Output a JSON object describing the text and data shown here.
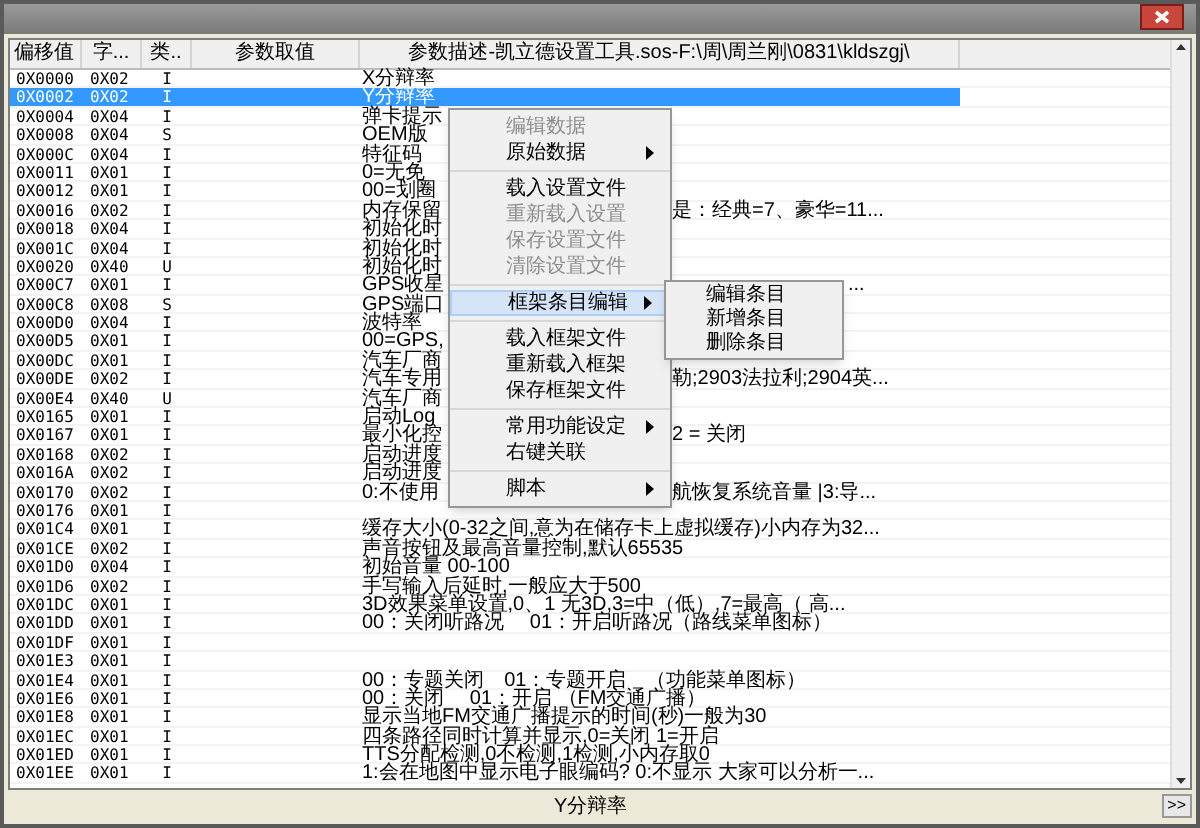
{
  "columns": [
    "偏移值",
    "字...",
    "类..",
    "参数取值",
    "参数描述-凯立德设置工具.sos-F:\\周\\周兰刚\\0831\\kldszgj\\"
  ],
  "rows": [
    {
      "offset": "0X0000",
      "size": "0X02",
      "type": "I",
      "description": "X分辩率",
      "selected": false
    },
    {
      "offset": "0X0002",
      "size": "0X02",
      "type": "I",
      "description": "Y分辩率",
      "selected": true
    },
    {
      "offset": "0X0004",
      "size": "0X04",
      "type": "I",
      "description": "弹卡提示",
      "selected": false
    },
    {
      "offset": "0X0008",
      "size": "0X04",
      "type": "S",
      "description": "OEM版",
      "selected": false
    },
    {
      "offset": "0X000C",
      "size": "0X04",
      "type": "I",
      "description": "特征码",
      "selected": false
    },
    {
      "offset": "0X0011",
      "size": "0X01",
      "type": "I",
      "description": "0=无免",
      "selected": false
    },
    {
      "offset": "0X0012",
      "size": "0X01",
      "type": "I",
      "description": "00=划圈",
      "selected": false
    },
    {
      "offset": "0X0016",
      "size": "0X02",
      "type": "I",
      "description": "内存保留",
      "description_tail": "是：经典=7、豪华=11...",
      "selected": false
    },
    {
      "offset": "0X0018",
      "size": "0X04",
      "type": "I",
      "description": "初始化时",
      "selected": false
    },
    {
      "offset": "0X001C",
      "size": "0X04",
      "type": "I",
      "description": "初始化时",
      "selected": false
    },
    {
      "offset": "0X0020",
      "size": "0X40",
      "type": "U",
      "description": "初始化时",
      "selected": false
    },
    {
      "offset": "0X00C7",
      "size": "0X01",
      "type": "I",
      "description": "GPS收星",
      "description_tail": "...",
      "kind": "tail_past_submenu",
      "selected": false
    },
    {
      "offset": "0X00C8",
      "size": "0X08",
      "type": "S",
      "description": "GPS端口",
      "selected": false
    },
    {
      "offset": "0X00D0",
      "size": "0X04",
      "type": "I",
      "description": "波特率",
      "selected": false
    },
    {
      "offset": "0X00D5",
      "size": "0X01",
      "type": "I",
      "description": "00=GPS,",
      "selected": false
    },
    {
      "offset": "0X00DC",
      "size": "0X01",
      "type": "I",
      "description": "汽车厂商",
      "selected": false
    },
    {
      "offset": "0X00DE",
      "size": "0X02",
      "type": "I",
      "description": "汽车专用",
      "description_tail": "勒;2903法拉利;2904英...",
      "selected": false
    },
    {
      "offset": "0X00E4",
      "size": "0X40",
      "type": "U",
      "description": "汽车厂商",
      "selected": false
    },
    {
      "offset": "0X0165",
      "size": "0X01",
      "type": "I",
      "description": "启动Log",
      "selected": false
    },
    {
      "offset": "0X0167",
      "size": "0X01",
      "type": "I",
      "description": "最小化控",
      "description_tail": "2 = 关闭",
      "selected": false
    },
    {
      "offset": "0X0168",
      "size": "0X02",
      "type": "I",
      "description": "启动进度",
      "selected": false
    },
    {
      "offset": "0X016A",
      "size": "0X02",
      "type": "I",
      "description": "启动进度",
      "selected": false
    },
    {
      "offset": "0X0170",
      "size": "0X02",
      "type": "I",
      "description": "0:不使用",
      "description_tail": "航恢复系统音量 |3:导...",
      "selected": false
    },
    {
      "offset": "0X0176",
      "size": "0X01",
      "type": "I",
      "selected": false
    },
    {
      "offset": "0X01C4",
      "size": "0X01",
      "type": "I",
      "description": "缓存大小(0-32之间,意为在储存卡上虚拟缓存)小内存为32...",
      "selected": false
    },
    {
      "offset": "0X01CE",
      "size": "0X02",
      "type": "I",
      "description": "声音按钮及最高音量控制,默认65535",
      "selected": false
    },
    {
      "offset": "0X01D0",
      "size": "0X04",
      "type": "I",
      "description": "初始音量 00-100",
      "selected": false
    },
    {
      "offset": "0X01D6",
      "size": "0X02",
      "type": "I",
      "description": "手写输入后延时,一般应大于500",
      "selected": false
    },
    {
      "offset": "0X01DC",
      "size": "0X01",
      "type": "I",
      "description": "3D效果菜单设置,0、1 无3D,3=中（低）,7=最高（ 高...",
      "selected": false
    },
    {
      "offset": "0X01DD",
      "size": "0X01",
      "type": "I",
      "description": "00：关闭听路况　 01：开启听路况（路线菜单图标）",
      "selected": false
    },
    {
      "offset": "0X01DF",
      "size": "0X01",
      "type": "I",
      "selected": false
    },
    {
      "offset": "0X01E3",
      "size": "0X01",
      "type": "I",
      "selected": false
    },
    {
      "offset": "0X01E4",
      "size": "0X01",
      "type": "I",
      "description": "00：专题关闭　01：专题开启　（功能菜单图标）",
      "selected": false
    },
    {
      "offset": "0X01E6",
      "size": "0X01",
      "type": "I",
      "description": "00：关闭　 01：开启 （FM交通广播）",
      "selected": false
    },
    {
      "offset": "0X01E8",
      "size": "0X01",
      "type": "I",
      "description": "显示当地FM交通广播提示的时间(秒)一般为30",
      "selected": false
    },
    {
      "offset": "0X01EC",
      "size": "0X01",
      "type": "I",
      "description": "四条路径同时计算并显示,0=关闭 1=开启",
      "selected": false
    },
    {
      "offset": "0X01ED",
      "size": "0X01",
      "type": "I",
      "description": "TTS分配检测,0不检测,1检测,小内存取0",
      "selected": false
    },
    {
      "offset": "0X01EE",
      "size": "0X01",
      "type": "I",
      "description": "1:会在地图中显示电子眼编码? 0:不显示 大家可以分析一...",
      "selected": false
    }
  ],
  "context_menu": {
    "groups": [
      [
        {
          "label": "编辑数据",
          "disabled": true,
          "selected": false,
          "submenu": false
        },
        {
          "label": "原始数据",
          "disabled": false,
          "selected": false,
          "submenu": true
        }
      ],
      [
        {
          "label": "载入设置文件",
          "disabled": false,
          "selected": false,
          "submenu": false
        },
        {
          "label": "重新载入设置",
          "disabled": true,
          "selected": false,
          "submenu": false
        },
        {
          "label": "保存设置文件",
          "disabled": true,
          "selected": false,
          "submenu": false
        },
        {
          "label": "清除设置文件",
          "disabled": true,
          "selected": false,
          "submenu": false
        }
      ],
      [
        {
          "label": "框架条目编辑",
          "disabled": false,
          "selected": true,
          "submenu": true
        }
      ],
      [
        {
          "label": "载入框架文件",
          "disabled": false,
          "selected": false,
          "submenu": false
        },
        {
          "label": "重新载入框架",
          "disabled": false,
          "selected": false,
          "submenu": false
        },
        {
          "label": "保存框架文件",
          "disabled": false,
          "selected": false,
          "submenu": false
        }
      ],
      [
        {
          "label": "常用功能设定",
          "disabled": false,
          "selected": false,
          "submenu": true
        },
        {
          "label": "右键关联",
          "disabled": false,
          "selected": false,
          "submenu": false
        }
      ],
      [
        {
          "label": "脚本",
          "disabled": false,
          "selected": false,
          "submenu": true
        }
      ]
    ]
  },
  "submenu": [
    "编辑条目",
    "新增条目",
    "删除条目"
  ],
  "status_bar": {
    "text": "Y分辩率",
    "button": ">>"
  }
}
